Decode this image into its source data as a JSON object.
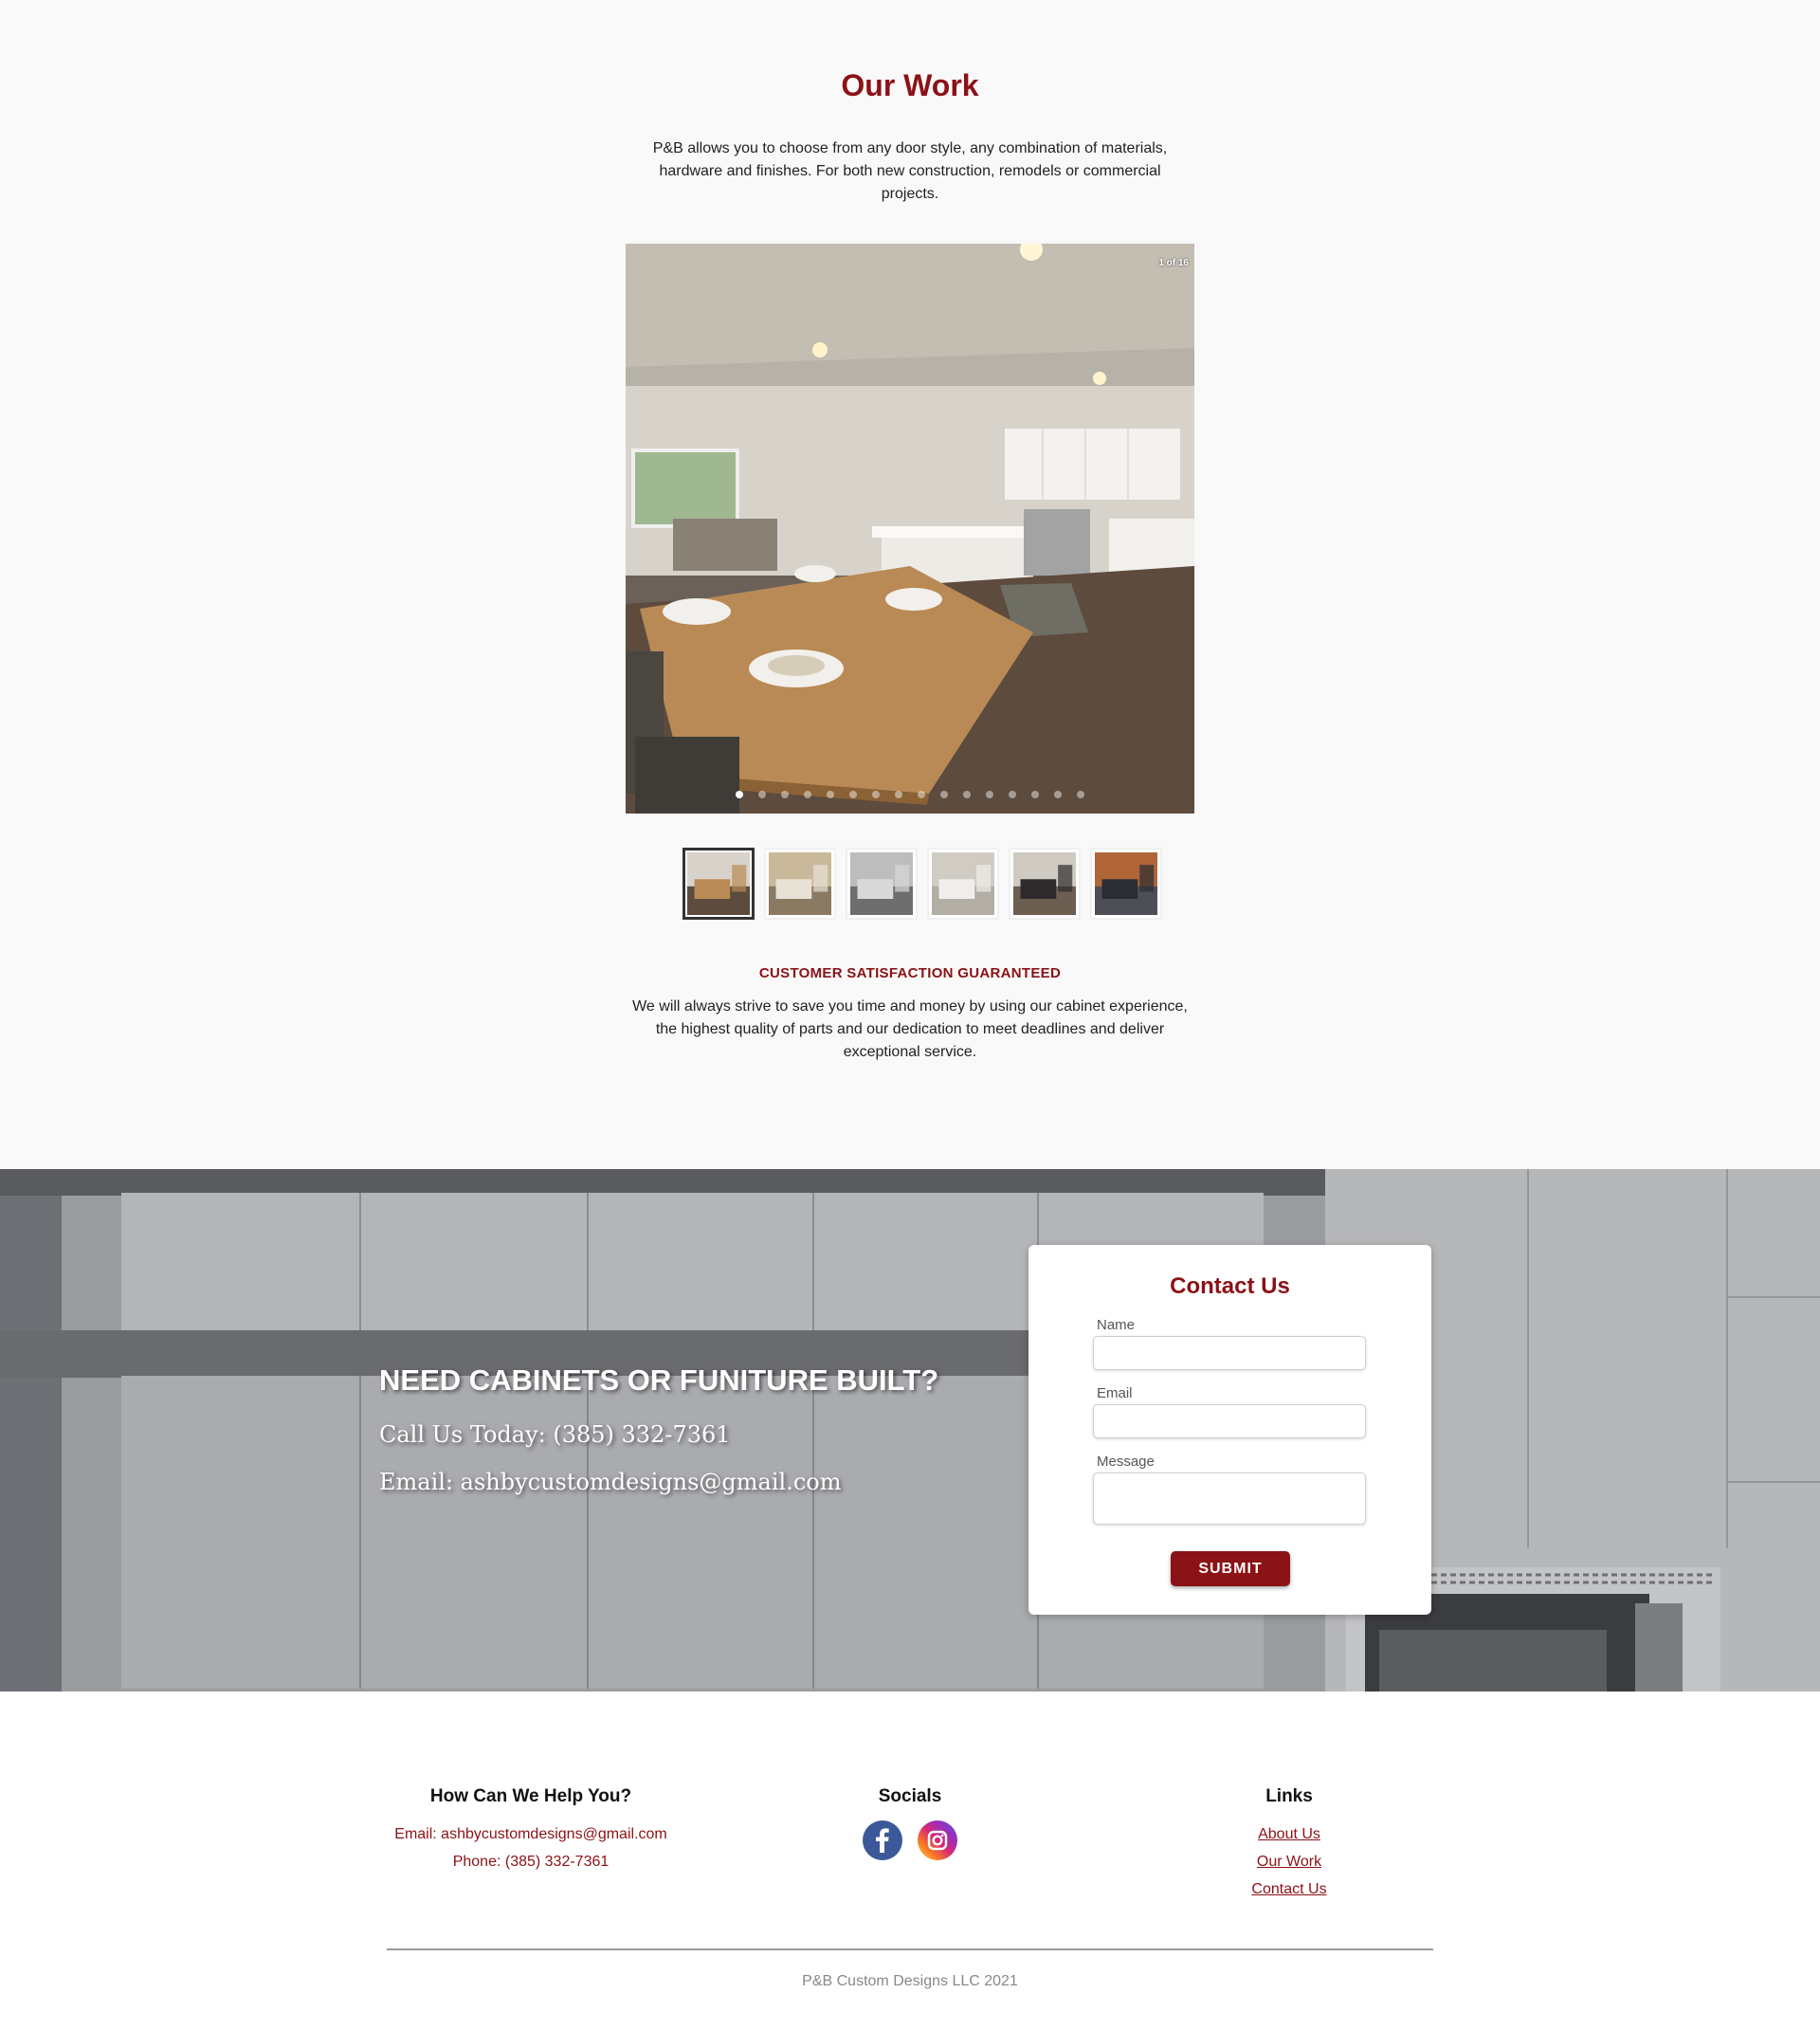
{
  "work": {
    "title": "Our Work",
    "intro": "P&B allows you to choose from any door style, any combination of materials, hardware and finishes. For both new construction, remodels or commercial projects.",
    "slider": {
      "counter": "1 of 16",
      "current": 1,
      "total": 16,
      "dot_count": 16
    },
    "thumbnails": [
      "kitchen-dining",
      "living-room",
      "bathroom-vanity",
      "bathroom-white",
      "dark-kitchen",
      "dark-cabinets"
    ],
    "guarantee_title": "CUSTOMER SATISFACTION GUARANTEED",
    "guarantee_text": "We will always strive to save you time and money by using our cabinet experience, the highest quality of parts and our dedication to meet deadlines and deliver exceptional service."
  },
  "band": {
    "headline": "NEED CABINETS OR FUNITURE BUILT?",
    "phone_line": "Call Us Today: (385) 332-7361",
    "email_line": "Email: ashbycustomdesigns@gmail.com"
  },
  "contact_form": {
    "title": "Contact Us",
    "name_label": "Name",
    "email_label": "Email",
    "message_label": "Message",
    "name_value": "",
    "email_value": "",
    "message_value": "",
    "submit_label": "SUBMIT"
  },
  "footer": {
    "help_heading": "How Can We Help You?",
    "help_email": "Email: ashbycustomdesigns@gmail.com",
    "help_phone": "Phone: (385) 332-7361",
    "socials_heading": "Socials",
    "socials": [
      {
        "name": "facebook-icon",
        "color": "#3b5998"
      },
      {
        "name": "instagram-icon",
        "color": "#d62976"
      }
    ],
    "links_heading": "Links",
    "links": [
      "About Us",
      "Our Work",
      "Contact Us"
    ],
    "copyright": "P&B Custom Designs LLC 2021"
  },
  "colors": {
    "accent": "#8b1216",
    "background": "#f9f9f9"
  }
}
